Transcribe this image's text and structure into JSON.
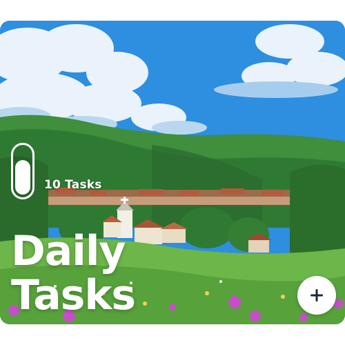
{
  "card": {
    "task_count": "10 Tasks",
    "title_line1": "Daily",
    "title_line2": "Tasks",
    "toggle_on": true
  },
  "icons": {
    "toggle": "toggle-switch-icon",
    "add": "plus-icon"
  },
  "colors": {
    "sky": "#2e8ee0",
    "hills": "#3f8f3d",
    "meadow": "#6db64a",
    "text": "#ffffff",
    "button_icon": "#1e2a3a"
  }
}
